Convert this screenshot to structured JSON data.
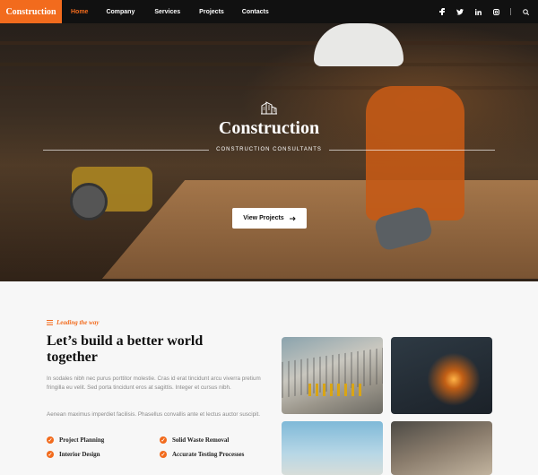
{
  "nav": {
    "brand": "Construction",
    "items": [
      {
        "label": "Home",
        "active": true
      },
      {
        "label": "Company",
        "active": false
      },
      {
        "label": "Services",
        "active": false
      },
      {
        "label": "Projects",
        "active": false
      },
      {
        "label": "Contacts",
        "active": false
      }
    ],
    "social_icons": [
      "facebook-icon",
      "twitter-icon",
      "linkedin-icon",
      "instagram-icon"
    ],
    "search_icon": "search-icon"
  },
  "hero": {
    "title": "Construction",
    "subtitle": "CONSTRUCTION CONSULTANTS",
    "button_label": "View Projects",
    "button_icon": "arrow-right-icon"
  },
  "about": {
    "eyebrow": "Leading the way",
    "heading": "Let’s build a better world together",
    "paragraph1": "In sodales nibh nec purus porttitor molestie. Cras id erat tincidunt arcu viverra pretium fringilla eu velit. Sed porta tincidunt eros at sagittis. Integer et cursus nibh.",
    "paragraph2": "Aenean maximus imperdiet facilisis. Phasellus convallis ante et lectus auctor suscipit.",
    "features": [
      "Project Planning",
      "Solid Waste Removal",
      "Interior Design",
      "Accurate Testing Processes"
    ]
  },
  "colors": {
    "accent": "#f26b1d",
    "nav_bg": "#111111",
    "page_bg": "#f7f7f7"
  }
}
